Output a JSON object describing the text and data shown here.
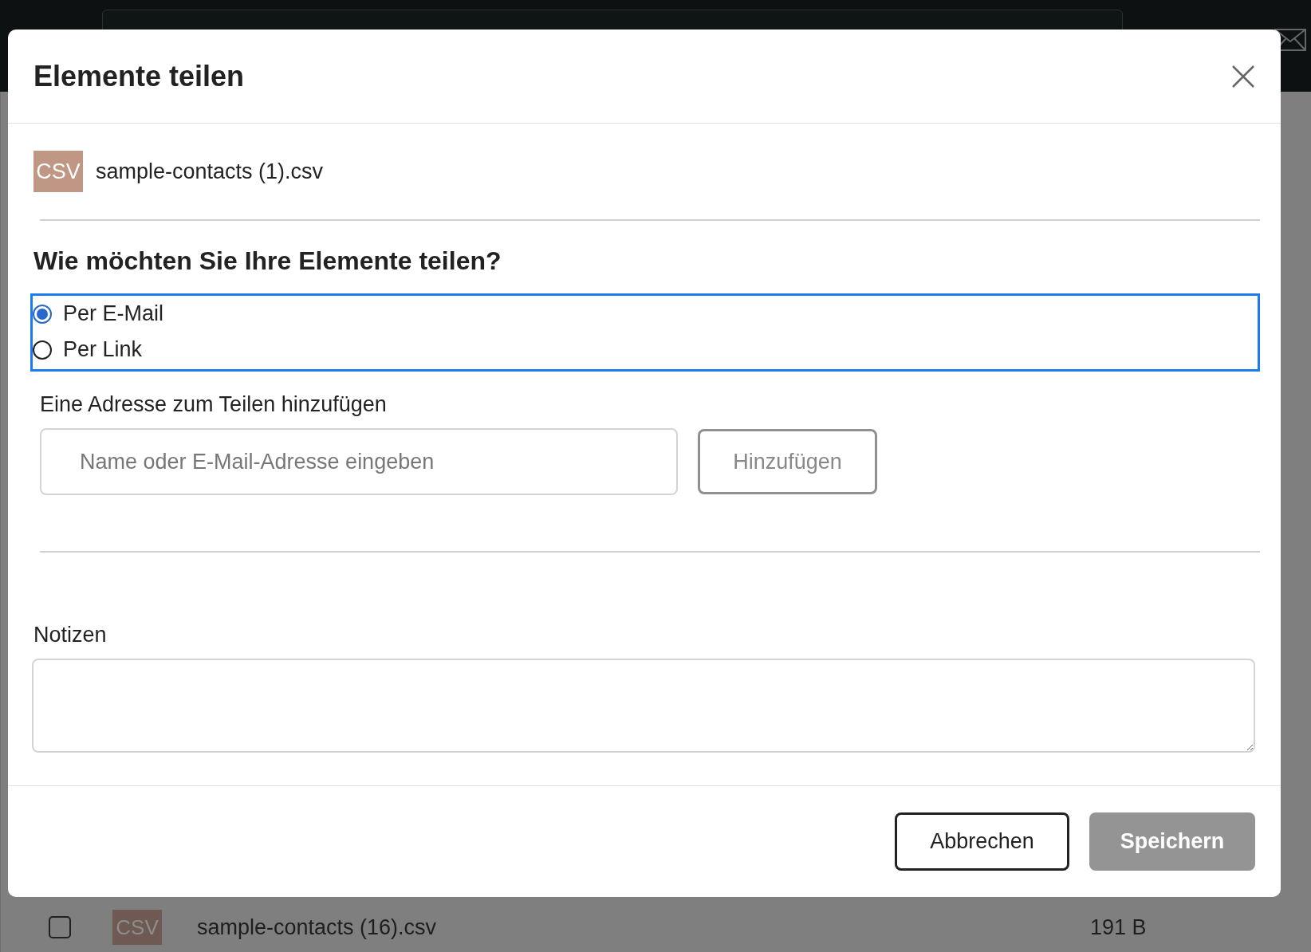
{
  "dialog": {
    "title": "Elemente teilen",
    "file": {
      "type": "CSV",
      "name": "sample-contacts (1).csv"
    },
    "question": "Wie möchten Sie Ihre Elemente teilen?",
    "options": [
      {
        "label": "Per E-Mail",
        "selected": true
      },
      {
        "label": "Per Link",
        "selected": false
      }
    ],
    "address": {
      "label": "Eine Adresse zum Teilen hinzufügen",
      "placeholder": "Name oder E-Mail-Adresse eingeben",
      "button": "Hinzufügen"
    },
    "notes": {
      "label": "Notizen"
    },
    "buttons": {
      "cancel": "Abbrechen",
      "save": "Speichern",
      "save_disabled": true
    }
  },
  "background_row": {
    "checked": false,
    "type": "CSV",
    "name": "sample-contacts (16).csv",
    "size": "191 B"
  }
}
